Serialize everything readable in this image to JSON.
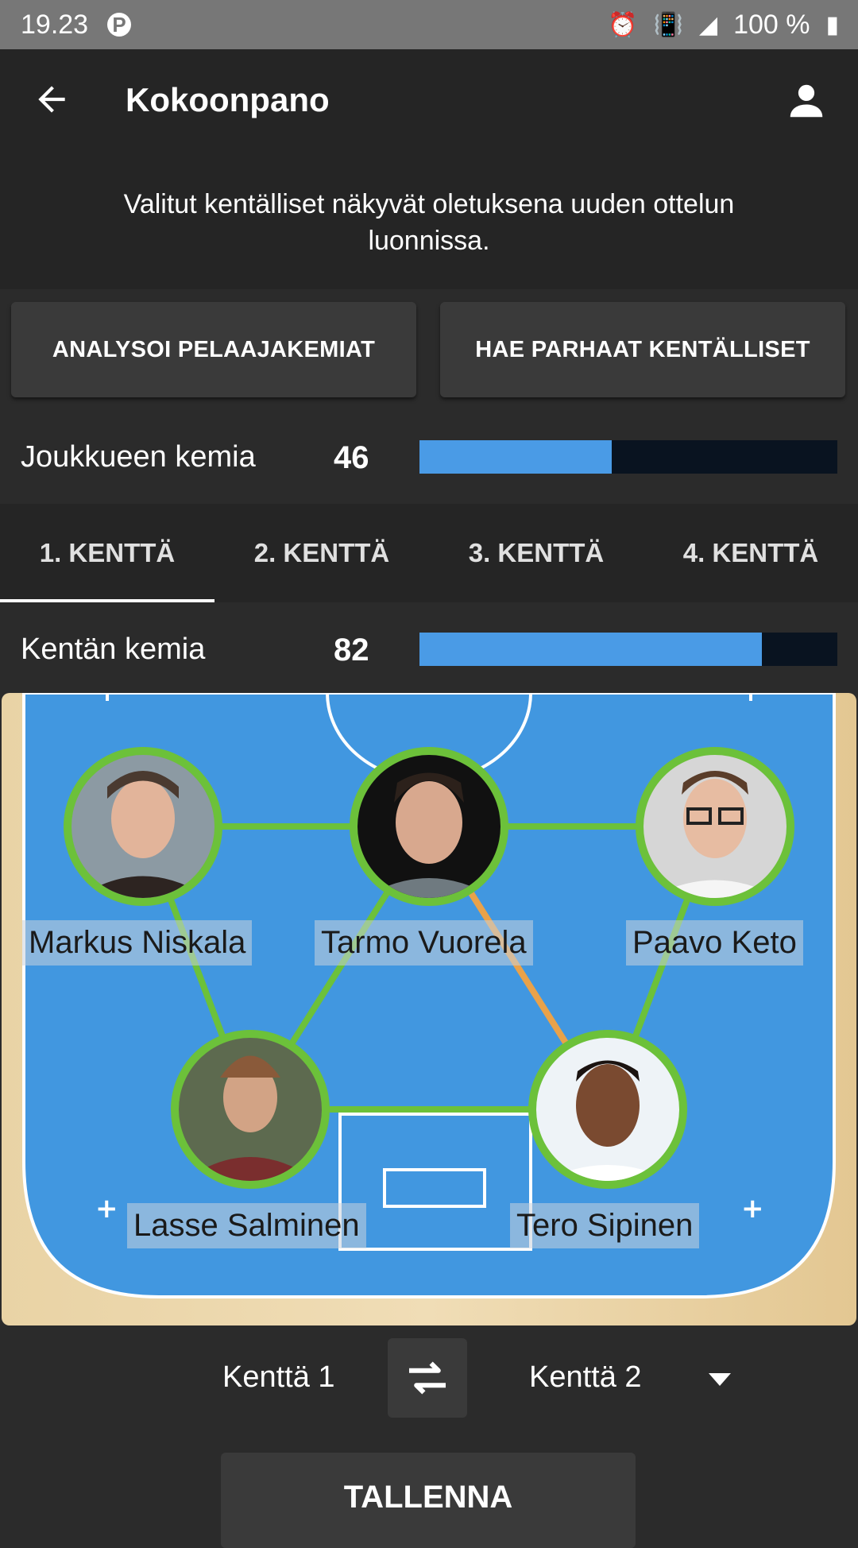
{
  "status_bar": {
    "time": "19.23",
    "battery": "100 %"
  },
  "app_bar": {
    "title": "Kokoonpano"
  },
  "info_text": "Valitut kentälliset näkyvät oletuksena uuden ottelun luonnissa.",
  "actions": {
    "analyze_label": "ANALYSOI PELAAJAKEMIAT",
    "best_label": "HAE PARHAAT KENTÄLLISET"
  },
  "team_chemistry": {
    "label": "Joukkueen kemia",
    "value": "46",
    "fraction": 0.46
  },
  "tabs": [
    {
      "label": "1. KENTTÄ",
      "selected": true
    },
    {
      "label": "2. KENTTÄ",
      "selected": false
    },
    {
      "label": "3. KENTTÄ",
      "selected": false
    },
    {
      "label": "4. KENTTÄ",
      "selected": false
    }
  ],
  "line_chemistry": {
    "label": "Kentän kemia",
    "value": "82",
    "fraction": 0.82
  },
  "players": [
    {
      "name": "Markus Niskala"
    },
    {
      "name": "Tarmo Vuorela"
    },
    {
      "name": "Paavo Keto"
    },
    {
      "name": "Lasse Salminen"
    },
    {
      "name": "Tero Sipinen"
    }
  ],
  "colors": {
    "accent": "#4a9be6",
    "good_link": "#6cc13a",
    "weak_link": "#e9a24a",
    "court": "#4197e0",
    "wood": "#e8cf9e"
  },
  "swap": {
    "left_label": "Kenttä 1",
    "right_label": "Kenttä 2"
  },
  "save_label": "TALLENNA"
}
